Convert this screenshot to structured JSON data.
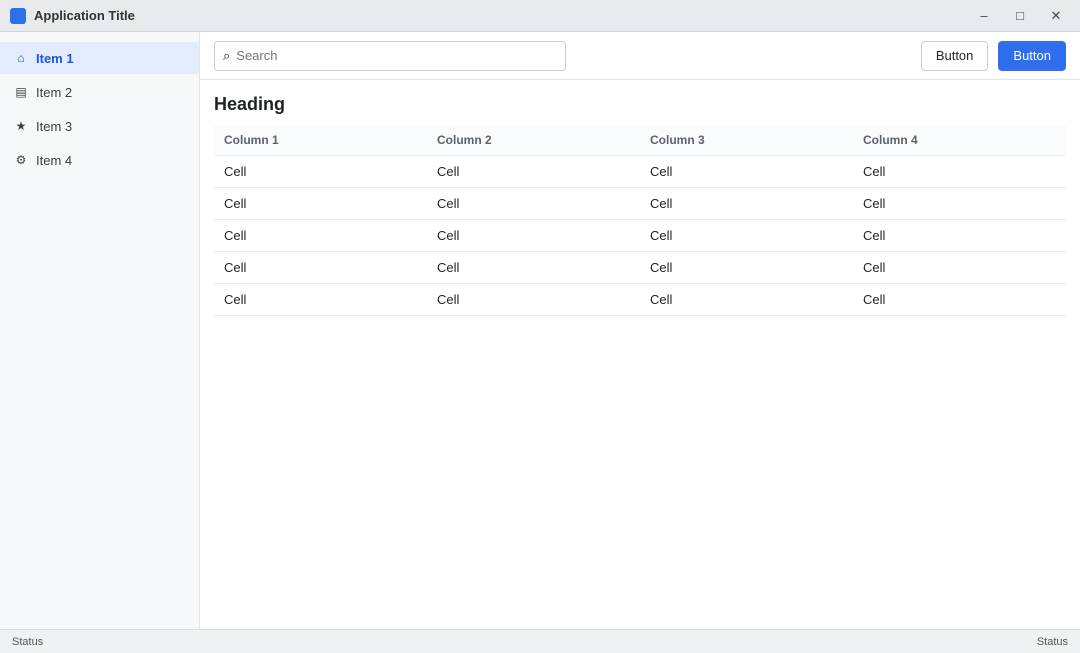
{
  "window": {
    "title": "Application Title",
    "minimize_glyph": "–",
    "maximize_glyph": "□",
    "close_glyph": "✕"
  },
  "sidebar": {
    "items": [
      {
        "label": "Item 1",
        "icon": "home-icon",
        "glyph": "⌂",
        "active": true
      },
      {
        "label": "Item 2",
        "icon": "folder-icon",
        "glyph": "▤",
        "active": false
      },
      {
        "label": "Item 3",
        "icon": "star-icon",
        "glyph": "★",
        "active": false
      },
      {
        "label": "Item 4",
        "icon": "gear-icon",
        "glyph": "⚙",
        "active": false
      }
    ]
  },
  "toolbar": {
    "search_placeholder": "Search",
    "search_icon_glyph": "⌕",
    "secondary_label": "Button",
    "primary_label": "Button"
  },
  "main": {
    "heading": "Heading",
    "columns": [
      "Column 1",
      "Column 2",
      "Column 3",
      "Column 4"
    ],
    "rows": [
      [
        "Cell",
        "Cell",
        "Cell",
        "Cell"
      ],
      [
        "Cell",
        "Cell",
        "Cell",
        "Cell"
      ],
      [
        "Cell",
        "Cell",
        "Cell",
        "Cell"
      ],
      [
        "Cell",
        "Cell",
        "Cell",
        "Cell"
      ],
      [
        "Cell",
        "Cell",
        "Cell",
        "Cell"
      ]
    ]
  },
  "statusbar": {
    "left": "Status",
    "right": "Status"
  },
  "colors": {
    "accent": "#2f6fed",
    "active_bg": "#e3ecfd"
  }
}
